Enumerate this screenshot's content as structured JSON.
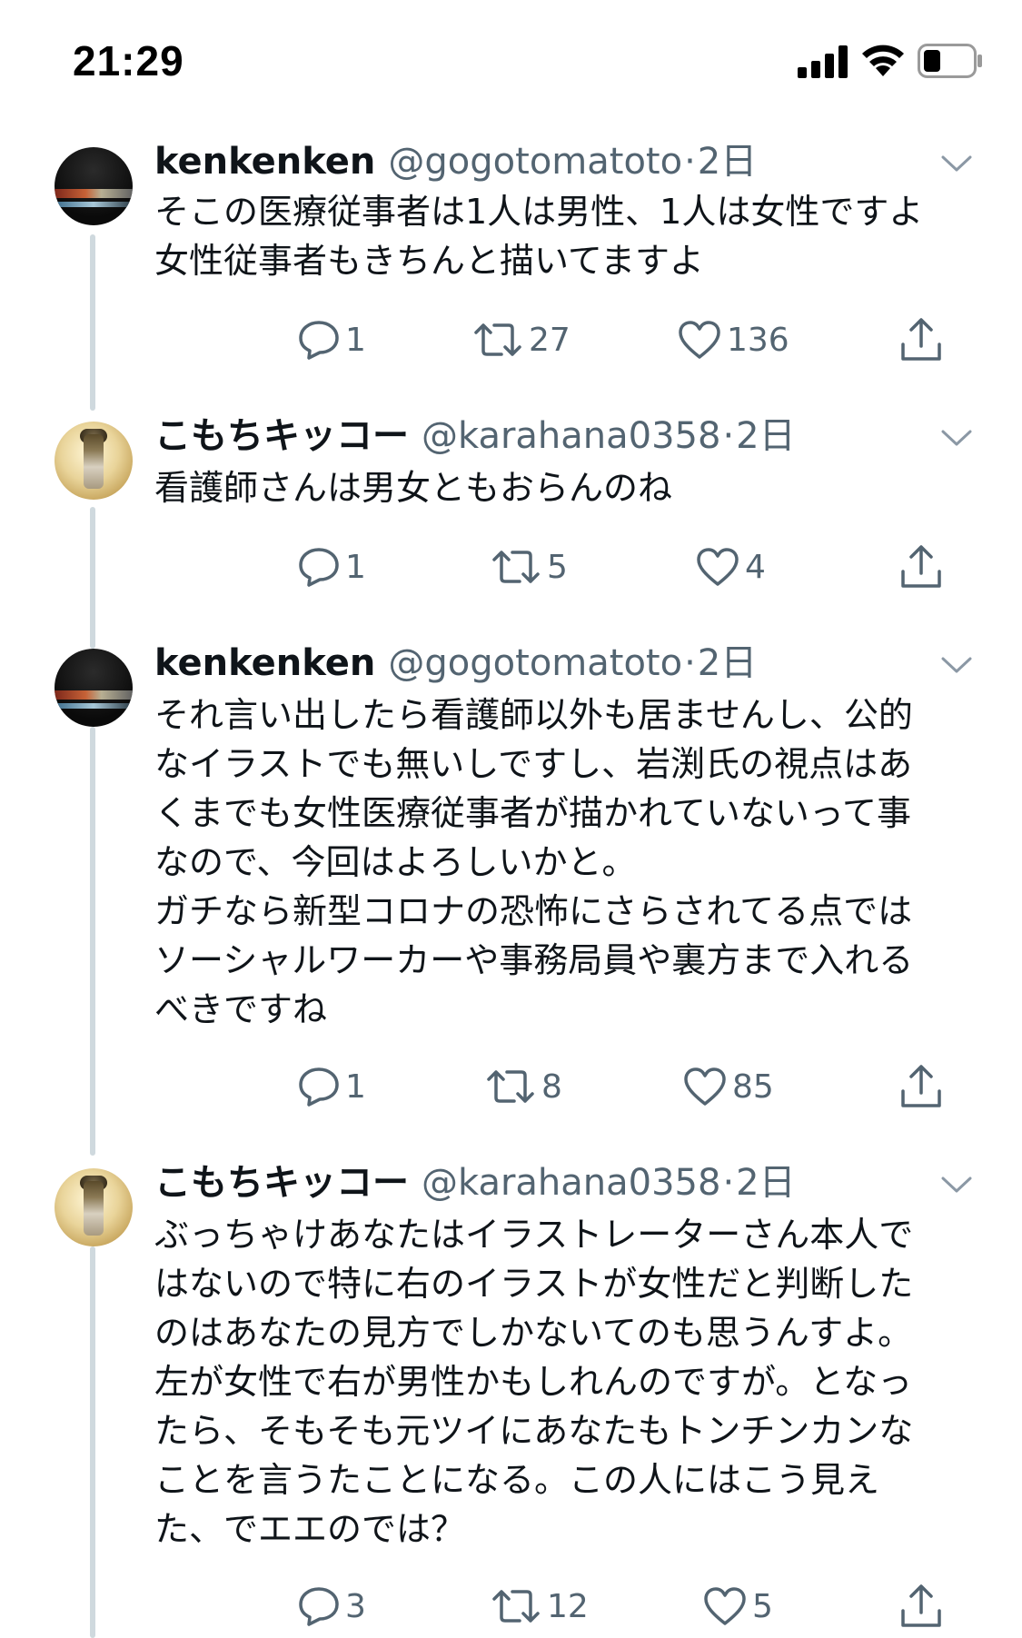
{
  "status_bar": {
    "time": "21:29",
    "signal_icon": "signal-bars-icon",
    "wifi_icon": "wifi-icon",
    "battery_icon": "battery-low-icon"
  },
  "tweets": [
    {
      "name": "kenkenken",
      "handle": "@gogotomatoto",
      "separator": "·",
      "time": "2日",
      "lines": [
        "そこの医療従事者は1人は男性、1人は女性ですよ",
        "女性従事者もきちんと描いてますよ"
      ],
      "replies": "1",
      "retweets": "27",
      "likes": "136"
    },
    {
      "name": "こもちキッコー",
      "handle": "@karahana0358",
      "separator": "·",
      "time": "2日",
      "lines": [
        "看護師さんは男女ともおらんのね"
      ],
      "replies": "1",
      "retweets": "5",
      "likes": "4"
    },
    {
      "name": "kenkenken",
      "handle": "@gogotomatoto",
      "separator": "·",
      "time": "2日",
      "lines": [
        "それ言い出したら看護師以外も居ませんし、公的",
        "なイラストでも無いしですし、岩渕氏の視点はあ",
        "くまでも女性医療従事者が描かれていないって事",
        "なので、今回はよろしいかと。",
        "ガチなら新型コロナの恐怖にさらされてる点では",
        "ソーシャルワーカーや事務局員や裏方まで入れる",
        "べきですね"
      ],
      "replies": "1",
      "retweets": "8",
      "likes": "85"
    },
    {
      "name": "こもちキッコー",
      "handle": "@karahana0358",
      "separator": "·",
      "time": "2日",
      "lines": [
        "ぶっちゃけあなたはイラストレーターさん本人で",
        "はないので特に右のイラストが女性だと判断した",
        "のはあなたの見方でしかないてのも思うんすよ。",
        "左が女性で右が男性かもしれんのですが。となっ",
        "たら、そもそも元ツイにあなたもトンチンカンな",
        "ことを言うたことになる。この人にはこう見え",
        "た、でエエのでは？"
      ],
      "replies": "3",
      "retweets": "12",
      "likes": "5"
    }
  ],
  "icons": {
    "reply": "reply-icon",
    "retweet": "retweet-icon",
    "like": "heart-icon",
    "share": "share-icon",
    "more": "chevron-down-icon"
  },
  "colors": {
    "text": "#0f1419",
    "secondary": "#536471",
    "thread_line": "#cfd9de"
  }
}
